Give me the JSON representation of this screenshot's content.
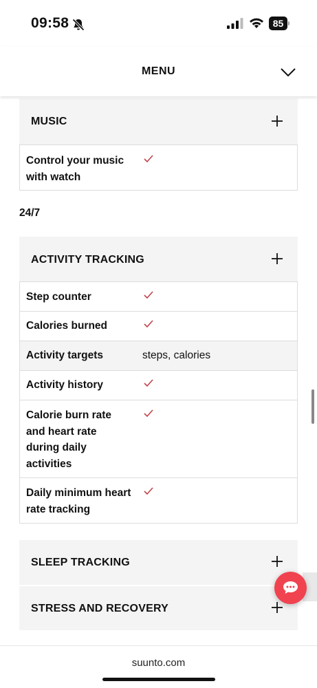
{
  "status_bar": {
    "time": "09:58",
    "battery": "85"
  },
  "header": {
    "title": "MENU"
  },
  "music": {
    "title": "MUSIC",
    "rows": [
      {
        "label": "Control your music with watch",
        "check": true
      }
    ]
  },
  "section_label": "24/7",
  "activity": {
    "title": "ACTIVITY TRACKING",
    "rows": [
      {
        "label": "Step counter",
        "check": true
      },
      {
        "label": "Calories burned",
        "check": true
      },
      {
        "label": "Activity targets",
        "value": "steps, calories"
      },
      {
        "label": "Activity history",
        "check": true
      },
      {
        "label": "Calorie burn rate and heart rate during daily activities",
        "check": true
      },
      {
        "label": "Daily minimum heart rate tracking",
        "check": true
      }
    ]
  },
  "sleep": {
    "title": "SLEEP TRACKING"
  },
  "stress": {
    "title": "STRESS AND RECOVERY"
  },
  "footer": {
    "url": "suunto.com"
  },
  "colors": {
    "check": "#c0444c",
    "chat": "#f0434f",
    "section_bg": "#f4f4f4"
  },
  "icons": {
    "bell": "bell-slash-icon",
    "signal": "signal-icon",
    "wifi": "wifi-icon",
    "expand": "plus-icon",
    "menu_toggle": "chevron-down-icon",
    "chat": "chat-bubble-icon",
    "check": "check-icon"
  }
}
